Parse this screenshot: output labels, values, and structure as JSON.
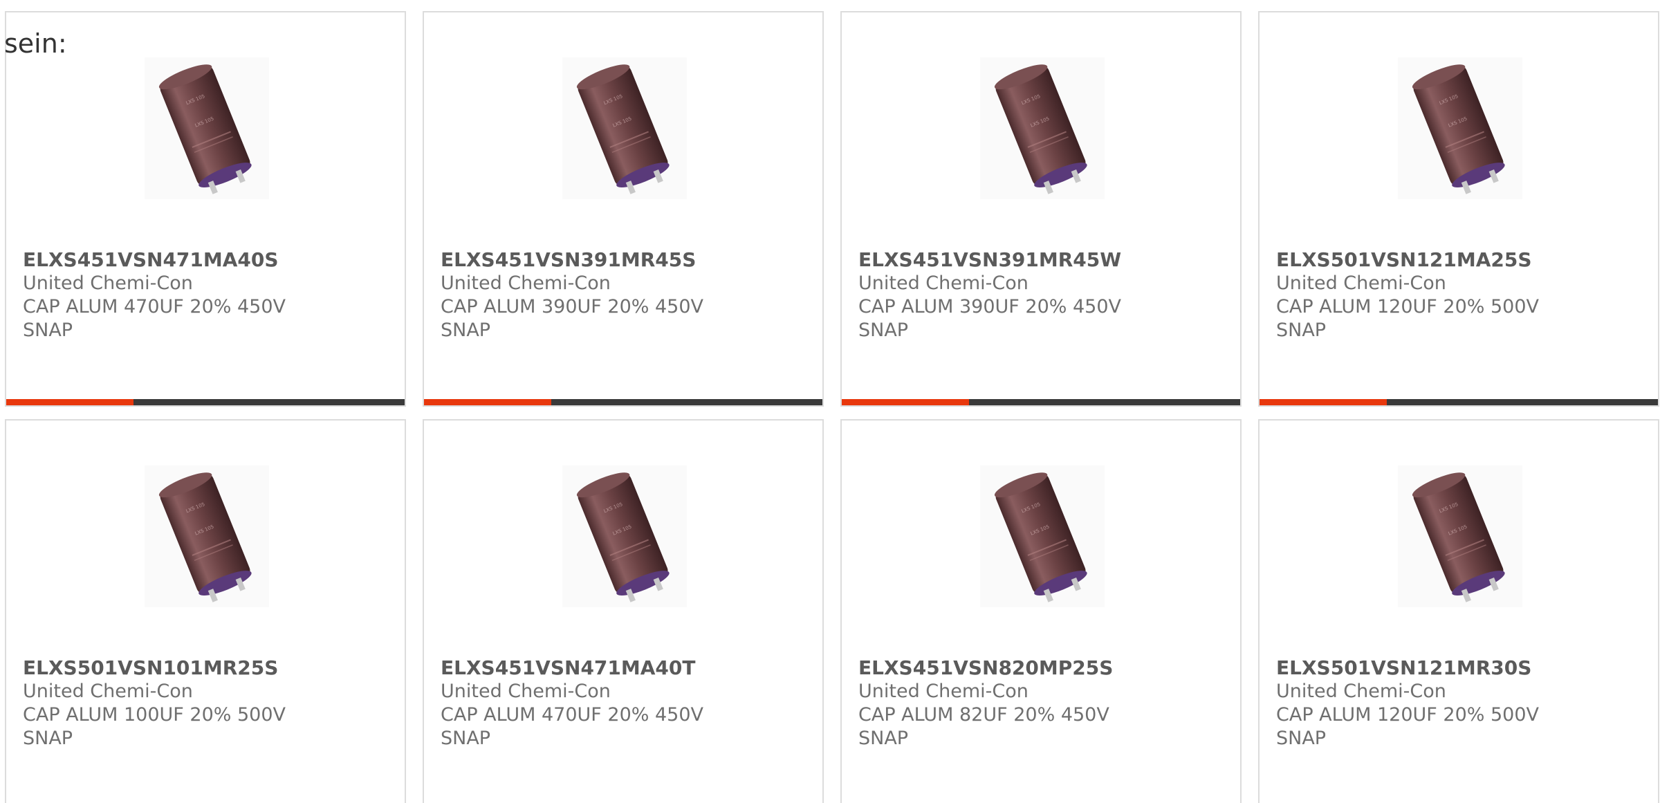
{
  "intro_text": "sein:",
  "accent_color": "#e8380d",
  "track_color": "#3a3a3a",
  "products": [
    {
      "part_number": "ELXS451VSN471MA40S",
      "manufacturer": "United Chemi-Con",
      "description": "CAP ALUM 470UF 20% 450V SNAP",
      "image_icon": "capacitor-image",
      "progress": 0.32
    },
    {
      "part_number": "ELXS451VSN391MR45S",
      "manufacturer": "United Chemi-Con",
      "description": "CAP ALUM 390UF 20% 450V SNAP",
      "image_icon": "capacitor-image",
      "progress": 0.32
    },
    {
      "part_number": "ELXS451VSN391MR45W",
      "manufacturer": "United Chemi-Con",
      "description": "CAP ALUM 390UF 20% 450V SNAP",
      "image_icon": "capacitor-image",
      "progress": 0.32
    },
    {
      "part_number": "ELXS501VSN121MA25S",
      "manufacturer": "United Chemi-Con",
      "description": "CAP ALUM 120UF 20% 500V SNAP",
      "image_icon": "capacitor-image",
      "progress": 0.32
    },
    {
      "part_number": "ELXS501VSN101MR25S",
      "manufacturer": "United Chemi-Con",
      "description": "CAP ALUM 100UF 20% 500V SNAP",
      "image_icon": "capacitor-image",
      "progress": null
    },
    {
      "part_number": "ELXS451VSN471MA40T",
      "manufacturer": "United Chemi-Con",
      "description": "CAP ALUM 470UF 20% 450V SNAP",
      "image_icon": "capacitor-image",
      "progress": null
    },
    {
      "part_number": "ELXS451VSN820MP25S",
      "manufacturer": "United Chemi-Con",
      "description": "CAP ALUM 82UF 20% 450V SNAP",
      "image_icon": "capacitor-image",
      "progress": null
    },
    {
      "part_number": "ELXS501VSN121MR30S",
      "manufacturer": "United Chemi-Con",
      "description": "CAP ALUM 120UF 20% 500V SNAP",
      "image_icon": "capacitor-image",
      "progress": null
    }
  ]
}
